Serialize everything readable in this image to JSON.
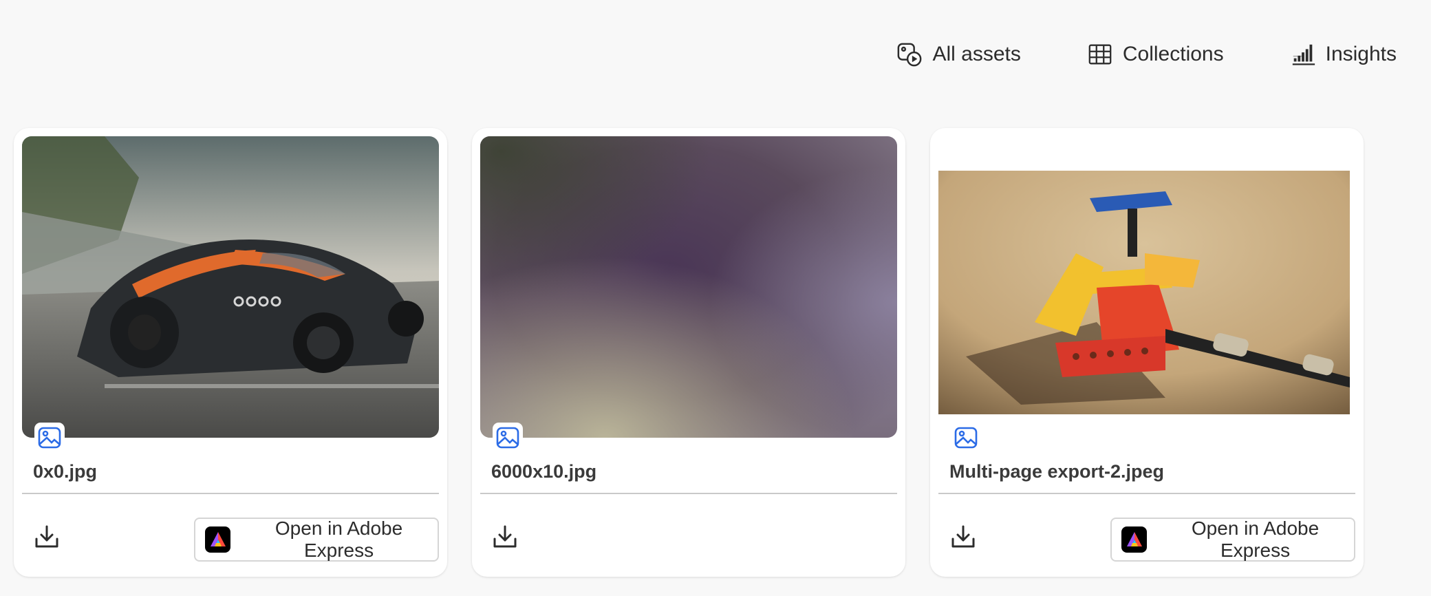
{
  "nav": {
    "items": [
      {
        "label": "All assets",
        "icon": "all-assets-icon"
      },
      {
        "label": "Collections",
        "icon": "grid-icon"
      },
      {
        "label": "Insights",
        "icon": "bar-chart-icon"
      }
    ]
  },
  "cards": [
    {
      "filename": "0x0.jpg",
      "thumbnail": "sports-car-image",
      "type_icon": "image-icon",
      "download_icon": "download-icon",
      "action_label": "Open in Adobe Express"
    },
    {
      "filename": "6000x10.jpg",
      "thumbnail": "blurred-gradient-image",
      "type_icon": "image-icon",
      "download_icon": "download-icon"
    },
    {
      "filename": "Multi-page export-2.jpeg",
      "thumbnail": "lego-model-image",
      "type_icon": "image-icon",
      "download_icon": "download-icon",
      "action_label": "Open in Adobe Express"
    }
  ],
  "colors": {
    "background": "#f8f8f8",
    "card": "#ffffff",
    "icon_blue": "#2b6be6",
    "text": "#2c2c2c"
  }
}
